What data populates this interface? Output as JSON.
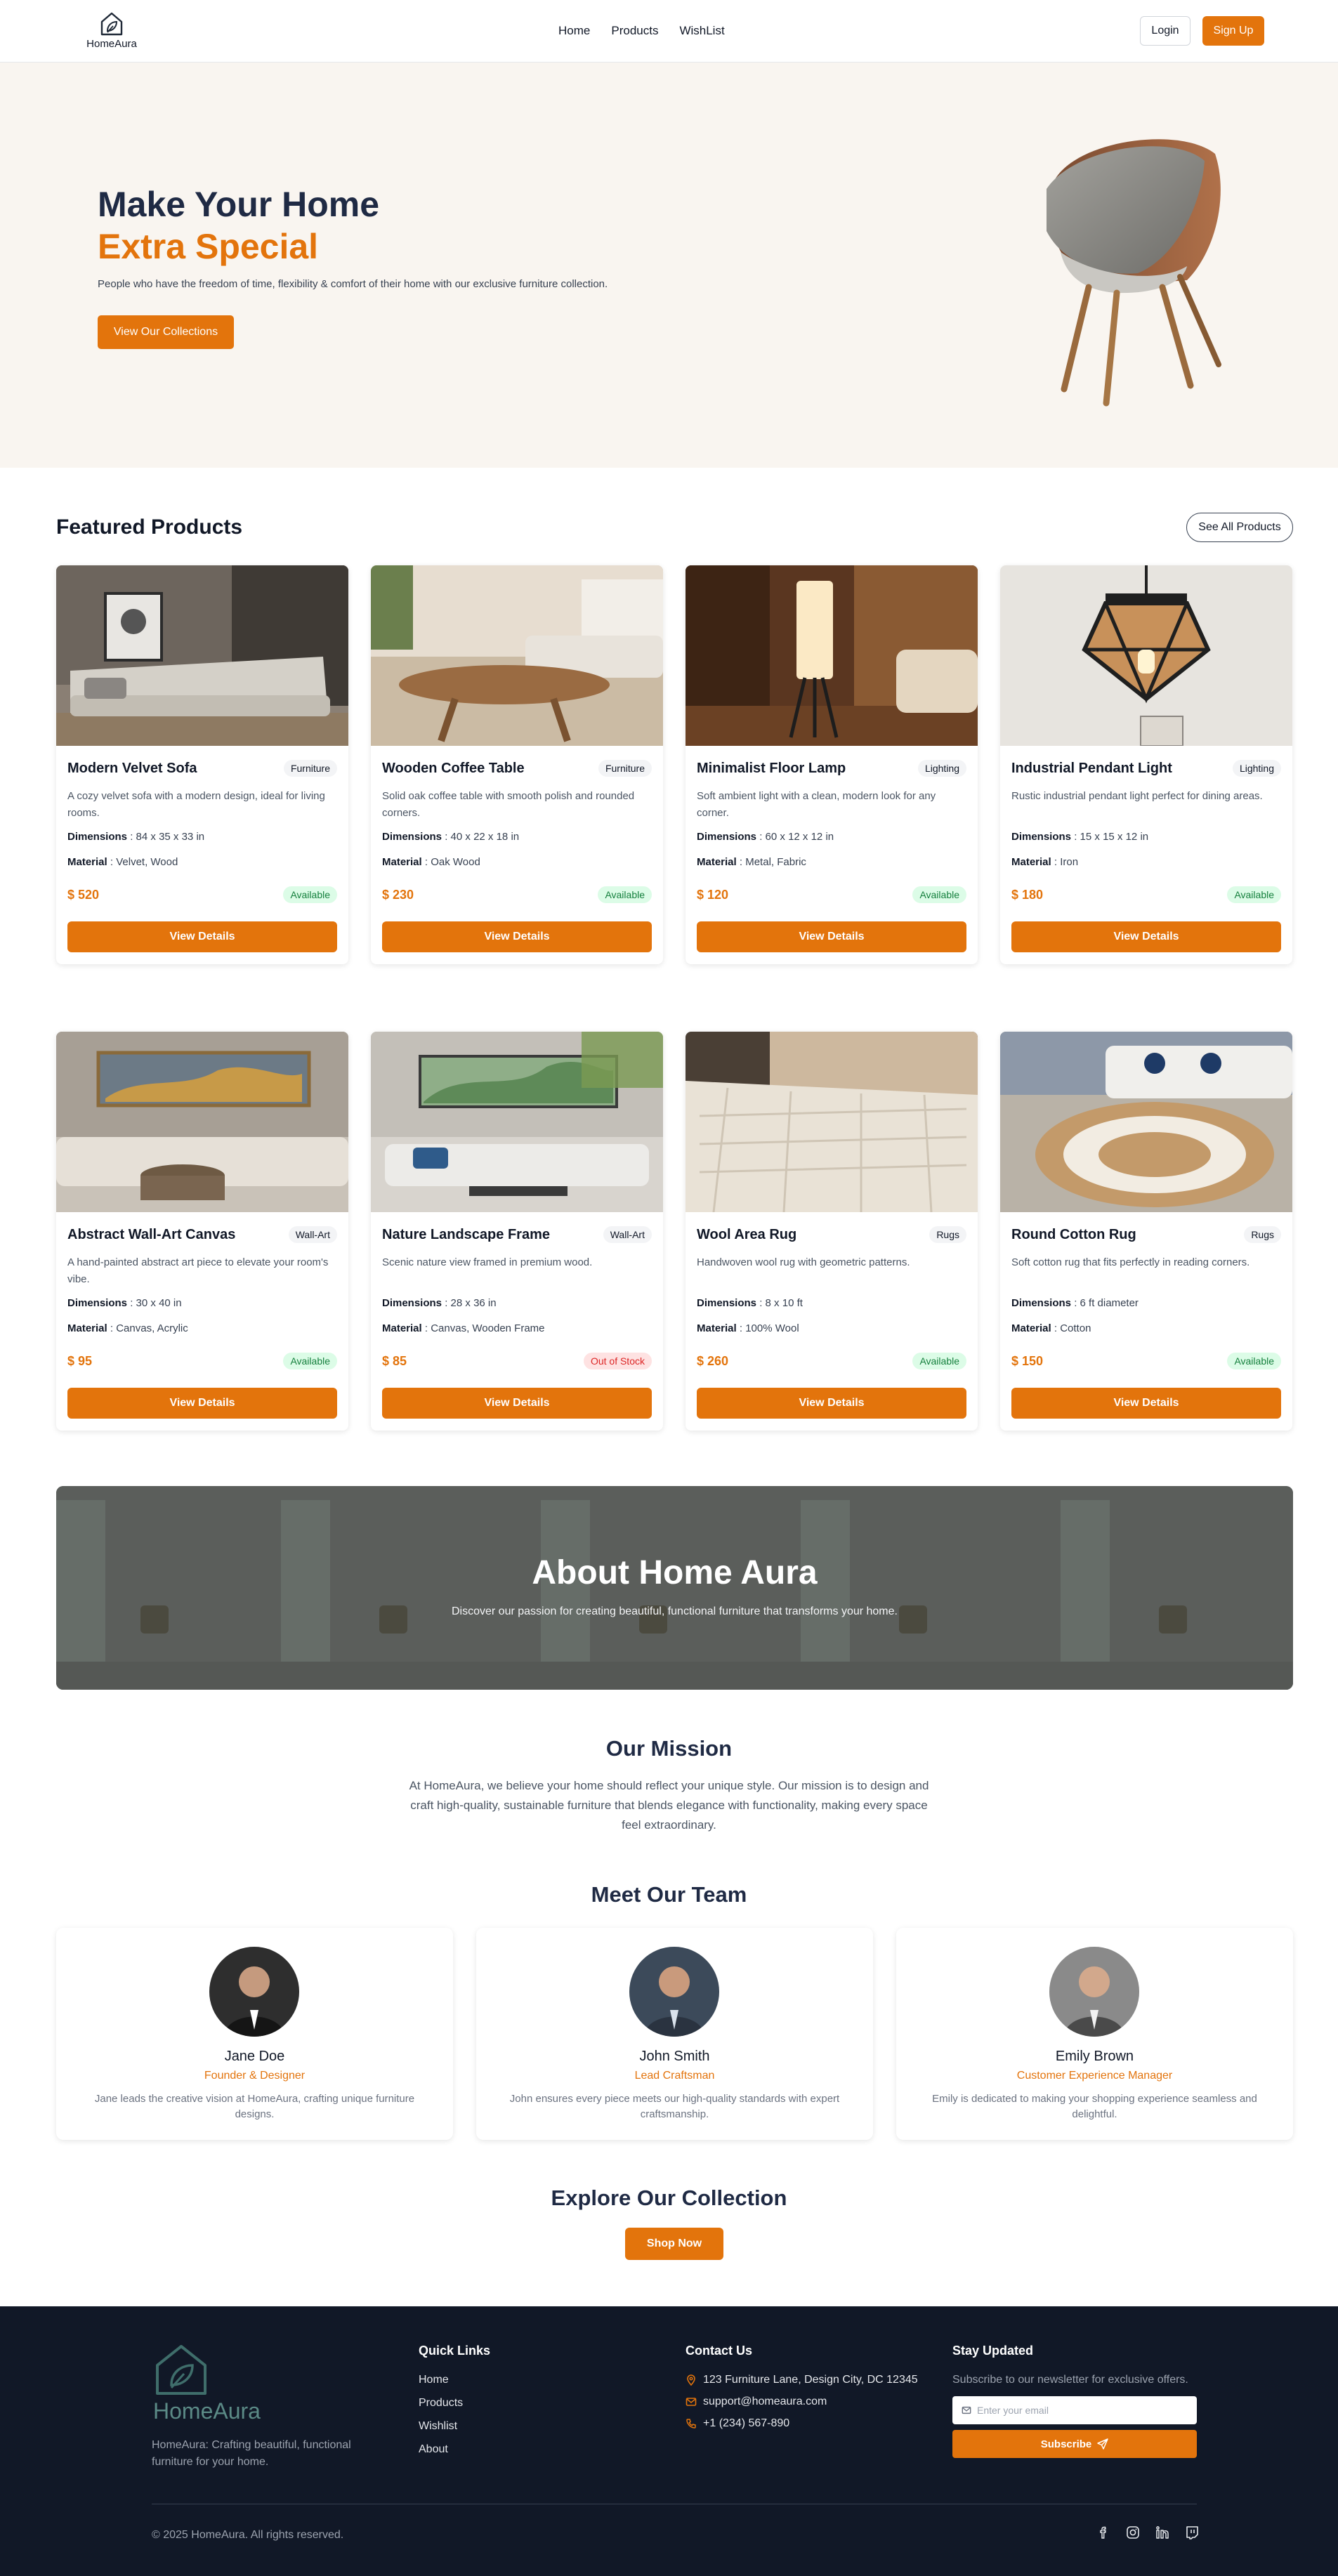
{
  "brand": {
    "name": "HomeAura",
    "accent": "#e3740c",
    "dark": "#111827"
  },
  "nav": {
    "links": [
      "Home",
      "Products",
      "WishList"
    ],
    "login": "Login",
    "signup": "Sign Up"
  },
  "hero": {
    "title_line1": "Make Your Home",
    "title_line2": "Extra Special",
    "subtitle": "People who have the freedom of time, flexibility & comfort of their home with our exclusive furniture collection.",
    "cta": "View Our Collections"
  },
  "featured": {
    "title": "Featured Products",
    "see_all": "See All Products",
    "dimensions_label": "Dimensions",
    "material_label": "Material",
    "details_button": "View Details",
    "products": [
      {
        "name": "Modern Velvet Sofa",
        "tag": "Furniture",
        "desc": "A cozy velvet sofa with a modern design, ideal for living rooms.",
        "dimensions": "84 x 35 x 33 in",
        "material": "Velvet, Wood",
        "price": "$ 520",
        "status": "Available"
      },
      {
        "name": "Wooden Coffee Table",
        "tag": "Furniture",
        "desc": "Solid oak coffee table with smooth polish and rounded corners.",
        "dimensions": "40 x 22 x 18 in",
        "material": "Oak Wood",
        "price": "$ 230",
        "status": "Available"
      },
      {
        "name": "Minimalist Floor Lamp",
        "tag": "Lighting",
        "desc": "Soft ambient light with a clean, modern look for any corner.",
        "dimensions": "60 x 12 x 12 in",
        "material": "Metal, Fabric",
        "price": "$ 120",
        "status": "Available"
      },
      {
        "name": "Industrial Pendant Light",
        "tag": "Lighting",
        "desc": "Rustic industrial pendant light perfect for dining areas.",
        "dimensions": "15 x 15 x 12 in",
        "material": "Iron",
        "price": "$ 180",
        "status": "Available"
      },
      {
        "name": "Abstract Wall-Art Canvas",
        "tag": "Wall-Art",
        "desc": "A hand-painted abstract art piece to elevate your room's vibe.",
        "dimensions": "30 x 40 in",
        "material": "Canvas, Acrylic",
        "price": "$ 95",
        "status": "Available"
      },
      {
        "name": "Nature Landscape Frame",
        "tag": "Wall-Art",
        "desc": "Scenic nature view framed in premium wood.",
        "dimensions": "28 x 36 in",
        "material": "Canvas, Wooden Frame",
        "price": "$ 85",
        "status": "Out of Stock"
      },
      {
        "name": "Wool Area Rug",
        "tag": "Rugs",
        "desc": "Handwoven wool rug with geometric patterns.",
        "dimensions": "8 x 10 ft",
        "material": "100% Wool",
        "price": "$ 260",
        "status": "Available"
      },
      {
        "name": "Round Cotton Rug",
        "tag": "Rugs",
        "desc": "Soft cotton rug that fits perfectly in reading corners.",
        "dimensions": "6 ft diameter",
        "material": "Cotton",
        "price": "$ 150",
        "status": "Available"
      }
    ]
  },
  "about": {
    "title": "About Home Aura",
    "subtitle": "Discover our passion for creating beautiful, functional furniture that transforms your home."
  },
  "mission": {
    "title": "Our Mission",
    "text": "At HomeAura, we believe your home should reflect your unique style. Our mission is to design and craft high-quality, sustainable furniture that blends elegance with functionality, making every space feel extraordinary."
  },
  "team": {
    "title": "Meet Our Team",
    "members": [
      {
        "name": "Jane Doe",
        "role": "Founder & Designer",
        "bio": "Jane leads the creative vision at HomeAura, crafting unique furniture designs."
      },
      {
        "name": "John Smith",
        "role": "Lead Craftsman",
        "bio": "John ensures every piece meets our high-quality standards with expert craftsmanship."
      },
      {
        "name": "Emily Brown",
        "role": "Customer Experience Manager",
        "bio": "Emily is dedicated to making your shopping experience seamless and delightful."
      }
    ]
  },
  "explore": {
    "title": "Explore Our Collection",
    "button": "Shop Now"
  },
  "footer": {
    "brand": "HomeAura",
    "tagline": "HomeAura: Crafting beautiful, functional furniture for your home.",
    "quick_links_title": "Quick Links",
    "quick_links": [
      "Home",
      "Products",
      "Wishlist",
      "About"
    ],
    "contact_title": "Contact Us",
    "address": "123 Furniture Lane, Design City, DC 12345",
    "email": "support@homeaura.com",
    "phone": "+1 (234) 567-890",
    "newsletter_title": "Stay Updated",
    "newsletter_text": "Subscribe to our newsletter for exclusive offers.",
    "email_placeholder": "Enter your email",
    "subscribe": "Subscribe",
    "copyright": "© 2025 HomeAura. All rights reserved.",
    "socials": [
      "facebook-icon",
      "instagram-icon",
      "linkedin-icon",
      "discord-icon"
    ]
  }
}
